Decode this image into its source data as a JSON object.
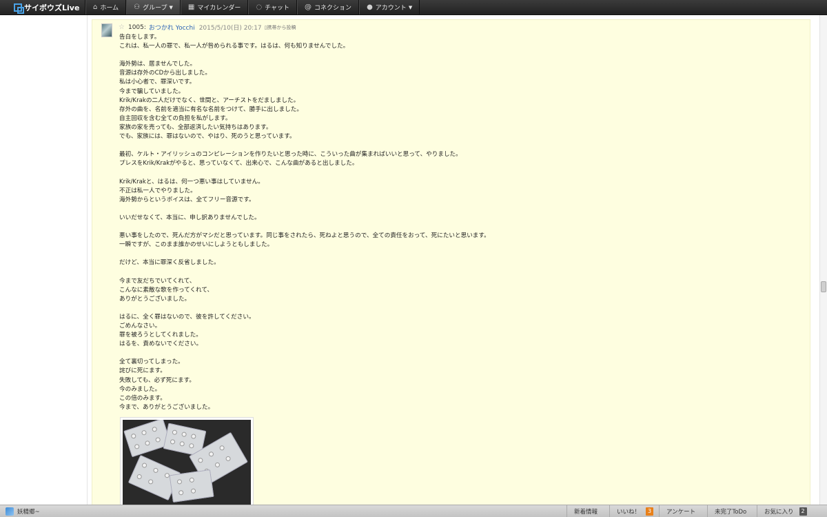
{
  "nav": {
    "logo": "サイボウズLive",
    "items": [
      {
        "label": "ホーム",
        "icon": "home-icon"
      },
      {
        "label": "グループ",
        "icon": "group-icon"
      },
      {
        "label": "マイカレンダー",
        "icon": "calendar-icon"
      },
      {
        "label": "チャット",
        "icon": "chat-icon"
      },
      {
        "label": "コネクション",
        "icon": "at-icon"
      },
      {
        "label": "アカウント",
        "icon": "person-icon"
      }
    ]
  },
  "post": {
    "number": "1005:",
    "author": "おつかれ Yocchi",
    "date": "2015/5/10(日) 20:17",
    "via": "携帯から投稿",
    "lines": [
      "告白をします。",
      "これは、私一人の罪で、私一人が咎められる事です。はるは、何も知りませんでした。",
      "",
      "海外勢は、居ませんでした。",
      "音源は存外のCDから出しました。",
      "私は小心者で、罪深いです。",
      "今まで騙していました。",
      "Krik/Krakの二人だけでなく、世間と、アーチストをだましました。",
      "存外の曲を、名前を適当に有名な名前をつけて、勝手に出しました。",
      "自主回収を含む全ての負担を私がします。",
      "家族の家を売っても、全部返済したい気持ちはあります。",
      "でも、家族には、罪はないので、やはり、死のうと思っています。",
      "",
      "最初、ケルト・アイリッシュのコンピレーションを作りたいと思った時に、こういった曲が集まればいいと思って、やりました。",
      "プレスをKrik/Krakがやると、思っていなくて、出来心で、こんな曲があると出しました。",
      "",
      "Krik/Krakと、はるは、何一つ悪い事はしていません。",
      "不正は私一人でやりました。",
      "海外勢からというボイスは、全てフリー音源です。",
      "",
      "いいだせなくて、本当に、申し訳ありませんでした。",
      "",
      "悪い事をしたので、死んだ方がマシだと思っています。同じ事をされたら、死ねよと思うので、全ての責任をおって、死にたいと思います。",
      "一瞬ですが、このまま誰かのせいにしようともしました。",
      "",
      "だけど、本当に罪深く反省しました。",
      "",
      "今まで友だちでいてくれて、",
      "こんなに素敵な歌を作ってくれて、",
      "ありがとうございました。",
      "",
      "はるに、全く罪はないので、彼を許してください。",
      "ごめんなさい。",
      "罪を被ろうとしてくれました。",
      "はるを、責めないでください。",
      "",
      "全て裏切ってしまった。",
      "詫びに死にます。",
      "失敗しても、必ず死にます。",
      "今のみました。",
      "この倍のみます。",
      "今まで、ありがとうございました。"
    ]
  },
  "bottom": {
    "user": "妖精郷~",
    "items": [
      {
        "label": "新着情報",
        "badge": ""
      },
      {
        "label": "いいね！",
        "badge": "3"
      },
      {
        "label": "アンケート",
        "badge": ""
      },
      {
        "label": "未完了ToDo",
        "badge": ""
      },
      {
        "label": "お気に入り",
        "badge": "2"
      }
    ]
  }
}
